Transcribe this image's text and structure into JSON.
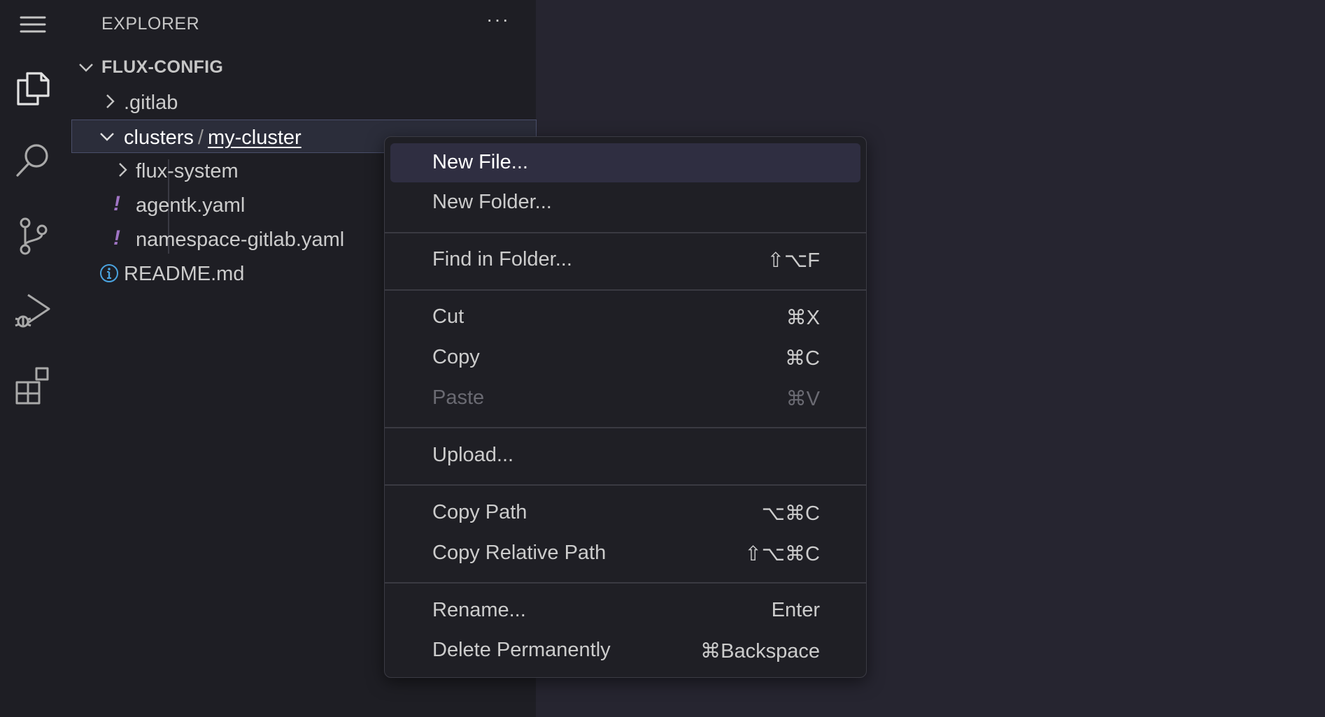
{
  "activity_bar": {
    "icons": [
      "menu-icon",
      "files-icon",
      "search-icon",
      "source-control-icon",
      "run-debug-icon",
      "extensions-icon"
    ]
  },
  "explorer": {
    "header": "EXPLORER",
    "more": "···",
    "root": "FLUX-CONFIG",
    "items": [
      {
        "label": ".gitlab"
      },
      {
        "label_part1": "clusters",
        "separator": "/",
        "label_part2": "my-cluster"
      },
      {
        "label": "flux-system"
      },
      {
        "label": "agentk.yaml",
        "icon_glyph": "!"
      },
      {
        "label": "namespace-gitlab.yaml",
        "icon_glyph": "!"
      },
      {
        "label": "README.md"
      }
    ]
  },
  "context_menu": {
    "items": [
      {
        "label": "New File...",
        "key": ""
      },
      {
        "label": "New Folder...",
        "key": ""
      },
      {
        "label": "Find in Folder...",
        "key": "⇧⌥F"
      },
      {
        "label": "Cut",
        "key": "⌘X"
      },
      {
        "label": "Copy",
        "key": "⌘C"
      },
      {
        "label": "Paste",
        "key": "⌘V"
      },
      {
        "label": "Upload...",
        "key": ""
      },
      {
        "label": "Copy Path",
        "key": "⌥⌘C"
      },
      {
        "label": "Copy Relative Path",
        "key": "⇧⌥⌘C"
      },
      {
        "label": "Rename...",
        "key": "Enter"
      },
      {
        "label": "Delete Permanently",
        "key": "⌘Backspace"
      }
    ]
  },
  "colors": {
    "background": "#262530",
    "sidebar": "#1e1e24",
    "menu_highlight": "#2f2e41",
    "yaml_icon": "#a074c4",
    "info_icon": "#4aa3df"
  }
}
